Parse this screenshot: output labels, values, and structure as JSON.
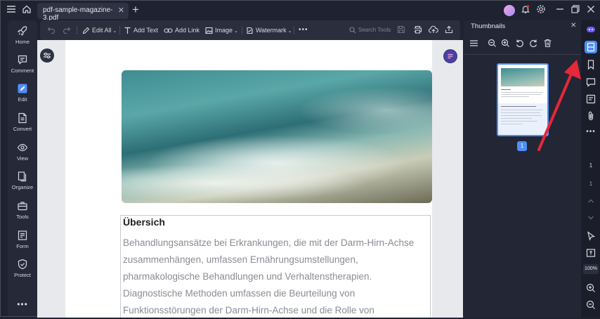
{
  "window": {
    "tab_title": "pdf-sample-magazine-3.pdf",
    "tab_close": "✕",
    "new_tab": "+"
  },
  "sidebar": {
    "items": [
      {
        "label": "Home",
        "icon": "rocket-icon"
      },
      {
        "label": "Comment",
        "icon": "comment-icon"
      },
      {
        "label": "Edit",
        "icon": "edit-icon"
      },
      {
        "label": "Convert",
        "icon": "convert-icon"
      },
      {
        "label": "View",
        "icon": "eye-icon"
      },
      {
        "label": "Organize",
        "icon": "organize-icon"
      },
      {
        "label": "Tools",
        "icon": "toolbox-icon"
      },
      {
        "label": "Form",
        "icon": "form-icon"
      },
      {
        "label": "Protect",
        "icon": "shield-icon"
      }
    ],
    "more": "•••"
  },
  "toolbar": {
    "edit_all": "Edit All",
    "add_text": "Add Text",
    "add_link": "Add Link",
    "image": "Image",
    "watermark": "Watermark",
    "more": "•••",
    "search_placeholder": "Search Tools"
  },
  "document": {
    "heading": "Übersich",
    "paragraph_lines": [
      "Behandlungsansätze bei Erkrankungen, die mit der Darm-Hirn-Achse",
      "zusammenhängen, umfassen Ernährungsumstellungen,",
      "pharmakologische Behandlungen und Verhaltenstherapien.",
      "Diagnostische Methoden umfassen die Beurteilung von",
      "Funktionsstörungen der Darm-Hirn-Achse und die Rolle von"
    ]
  },
  "thumbnails": {
    "title": "Thumbnails",
    "close": "✕",
    "page_number": "1"
  },
  "rail": {
    "page_current": "1",
    "page_total": "1",
    "zoom": "100%"
  },
  "colors": {
    "accent": "#4f8ff7",
    "annotation_arrow": "#e5283a"
  }
}
